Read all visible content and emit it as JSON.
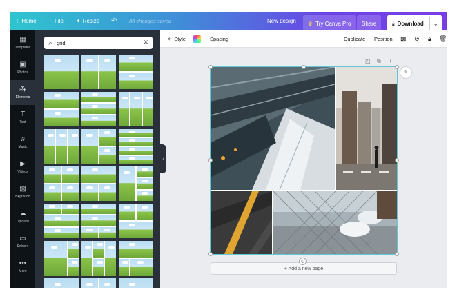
{
  "topbar": {
    "home": "Home",
    "file": "File",
    "resize": "Resize",
    "saved": "All changes saved",
    "new_design": "New design",
    "try_pro": "Try Canva Pro",
    "share": "Share",
    "download": "Download",
    "back_icon": "chevron-left-icon",
    "undo_icon": "undo-icon",
    "colors": {
      "gradient_start": "#2ec5cf",
      "gradient_end": "#7b3ce8"
    }
  },
  "rail": {
    "items": [
      {
        "label": "Templates",
        "icon": "templates-icon"
      },
      {
        "label": "Photos",
        "icon": "photo-icon"
      },
      {
        "label": "Elements",
        "icon": "elements-icon",
        "active": true
      },
      {
        "label": "Text",
        "icon": "text-icon"
      },
      {
        "label": "Music",
        "icon": "music-icon"
      },
      {
        "label": "Videos",
        "icon": "video-icon"
      },
      {
        "label": "Bkground",
        "icon": "background-icon"
      },
      {
        "label": "Uploads",
        "icon": "upload-icon"
      },
      {
        "label": "Folders",
        "icon": "folder-icon"
      },
      {
        "label": "More",
        "icon": "more-icon"
      }
    ]
  },
  "search": {
    "value": "grid",
    "placeholder": "Search"
  },
  "toolbar": {
    "style": "Style",
    "spacing": "Spacing",
    "duplicate": "Duplicate",
    "position": "Position"
  },
  "canvas": {
    "add_page": "+ Add a new page"
  }
}
